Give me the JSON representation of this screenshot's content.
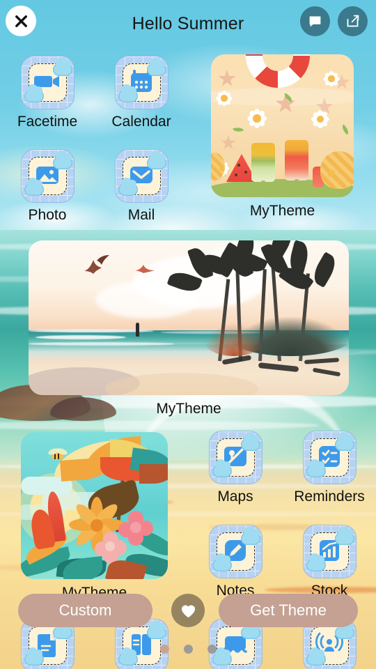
{
  "header": {
    "title": "Hello Summer",
    "close_icon": "close-x-icon",
    "comment_icon": "comment-bubble-icon",
    "share_icon": "share-external-link-icon"
  },
  "home_screen": {
    "apps_top": [
      {
        "label": "Facetime",
        "icon": "facetime-video-camera-icon"
      },
      {
        "label": "Calendar",
        "icon": "calendar-icon"
      },
      {
        "label": "Photo",
        "icon": "photos-image-icon"
      },
      {
        "label": "Mail",
        "icon": "mail-envelope-icon"
      }
    ],
    "apps_bottom": [
      {
        "label": "Maps",
        "icon": "maps-pin-icon"
      },
      {
        "label": "Reminders",
        "icon": "reminders-checklist-icon"
      },
      {
        "label": "Notes",
        "icon": "notes-pencil-icon"
      },
      {
        "label": "Stock",
        "icon": "stocks-chart-icon"
      }
    ],
    "dock": [
      {
        "icon": "pages-document-icon"
      },
      {
        "icon": "books-icon"
      },
      {
        "icon": "weather-cloud-icon"
      },
      {
        "icon": "airdrop-podcast-icon"
      }
    ],
    "theme_cards": [
      {
        "label": "MyTheme",
        "art": "summer-beach-pattern-icon-set"
      },
      {
        "label": "MyTheme",
        "art": "sunset-palm-beach-wallpaper"
      },
      {
        "label": "MyTheme",
        "art": "tropical-flowers-parasol-wallpaper"
      }
    ]
  },
  "bottom_bar": {
    "custom_label": "Custom",
    "get_theme_label": "Get Theme",
    "favorite_icon": "heart-icon",
    "pagination": {
      "total": 3,
      "active_index": 0
    }
  },
  "colors": {
    "sky": "#6dcbe4",
    "sea": "#3ba89f",
    "sand": "#f8dd97",
    "pill": "#c4a193",
    "round_button": "#3a7a8c",
    "icon_tile": "#b8d3f2",
    "icon_glyph": "#3d9aea",
    "icon_inner": "#fdf3d8"
  }
}
